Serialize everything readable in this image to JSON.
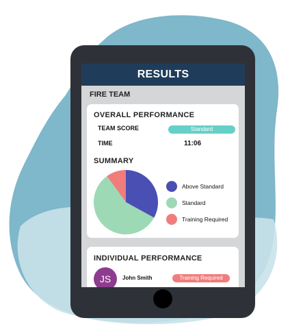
{
  "header": {
    "title": "RESULTS"
  },
  "team": {
    "name": "FIRE TEAM"
  },
  "overall": {
    "title": "OVERALL PERFORMANCE",
    "team_score_label": "TEAM SCORE",
    "team_score_value": "Standard",
    "time_label": "TIME",
    "time_value": "11:06"
  },
  "summary": {
    "title": "SUMMARY",
    "legend": [
      {
        "label": "Above Standard",
        "color": "#4a4fb4"
      },
      {
        "label": "Standard",
        "color": "#9dd9b5"
      },
      {
        "label": "Training Required",
        "color": "#f07c7c"
      }
    ]
  },
  "chart_data": {
    "type": "pie",
    "categories": [
      "Above Standard",
      "Standard",
      "Training Required"
    ],
    "values": [
      33,
      57,
      10
    ],
    "colors": [
      "#4a4fb4",
      "#9dd9b5",
      "#f07c7c"
    ]
  },
  "individual": {
    "title": "INDIVIDUAL PERFORMANCE",
    "members": [
      {
        "initials": "JS",
        "name": "John Smith",
        "status": "Training Required",
        "status_color": "#f07c7c",
        "avatar_color": "#8e3c8f"
      }
    ]
  },
  "colors": {
    "header_bg": "#1f3d5a",
    "standard_pill": "#66d0c8",
    "training_pill": "#f07c7c"
  }
}
